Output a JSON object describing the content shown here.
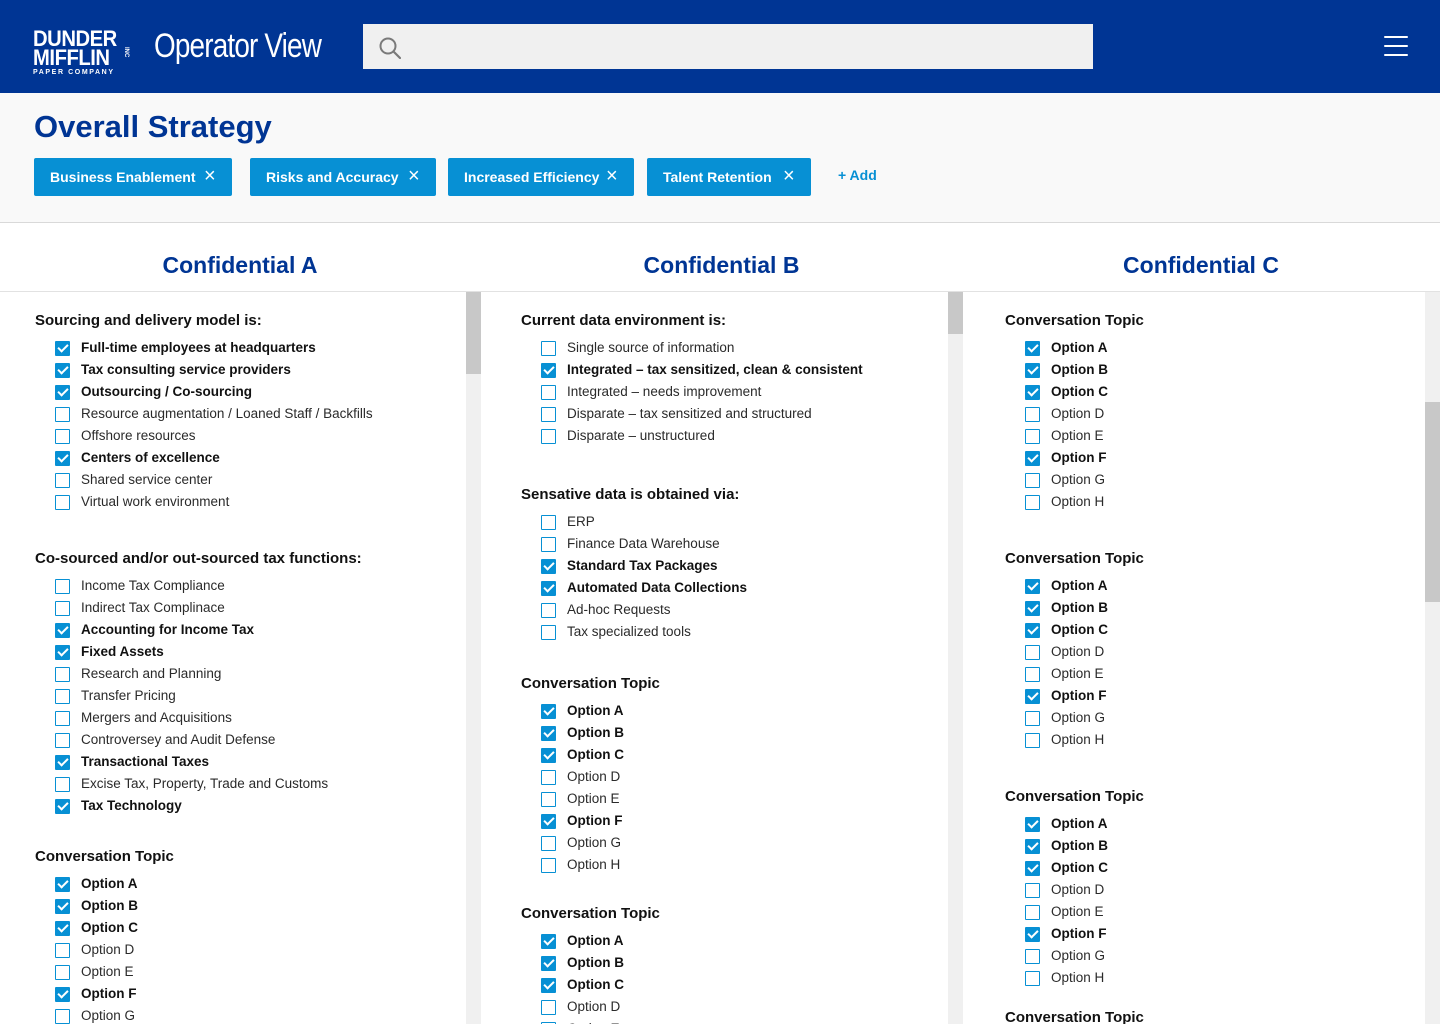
{
  "header": {
    "logo_line1": "DUNDER",
    "logo_line2": "MIFFLIN",
    "logo_sub": "PAPER COMPANY",
    "logo_inc": "INC",
    "app_title": "Operator View",
    "search_placeholder": ""
  },
  "strategy": {
    "title": "Overall Strategy",
    "tags": [
      "Business Enablement",
      "Risks and Accuracy",
      "Increased Efficiency",
      "Talent Retention"
    ],
    "remove_glyph": "×",
    "add_label": "+ Add"
  },
  "columns": [
    {
      "title": "Confidential A",
      "groups": [
        {
          "title": "Sourcing and delivery model is:",
          "options": [
            {
              "label": "Full-time employees at headquarters",
              "checked": true
            },
            {
              "label": "Tax consulting service providers",
              "checked": true
            },
            {
              "label": "Outsourcing / Co-sourcing",
              "checked": true
            },
            {
              "label": "Resource augmentation / Loaned Staff / Backfills",
              "checked": false
            },
            {
              "label": "Offshore resources",
              "checked": false
            },
            {
              "label": "Centers of excellence",
              "checked": true
            },
            {
              "label": "Shared service center",
              "checked": false
            },
            {
              "label": "Virtual work environment",
              "checked": false
            }
          ]
        },
        {
          "title": "Co-sourced and/or out-sourced tax functions:",
          "options": [
            {
              "label": "Income Tax Compliance",
              "checked": false
            },
            {
              "label": "Indirect Tax Complinace",
              "checked": false
            },
            {
              "label": "Accounting for Income Tax",
              "checked": true
            },
            {
              "label": "Fixed Assets",
              "checked": true
            },
            {
              "label": "Research and Planning",
              "checked": false
            },
            {
              "label": "Transfer Pricing",
              "checked": false
            },
            {
              "label": "Mergers and Acquisitions",
              "checked": false
            },
            {
              "label": "Controversey and Audit Defense",
              "checked": false
            },
            {
              "label": "Transactional Taxes",
              "checked": true
            },
            {
              "label": "Excise Tax, Property, Trade and Customs",
              "checked": false
            },
            {
              "label": "Tax Technology",
              "checked": true
            }
          ]
        },
        {
          "title": "Conversation Topic",
          "options": [
            {
              "label": "Option A",
              "checked": true
            },
            {
              "label": "Option B",
              "checked": true
            },
            {
              "label": "Option C",
              "checked": true
            },
            {
              "label": "Option D",
              "checked": false
            },
            {
              "label": "Option E",
              "checked": false
            },
            {
              "label": "Option F",
              "checked": true
            },
            {
              "label": "Option G",
              "checked": false
            }
          ]
        }
      ]
    },
    {
      "title": "Confidential B",
      "groups": [
        {
          "title": "Current data environment is:",
          "options": [
            {
              "label": "Single source of information",
              "checked": false
            },
            {
              "label": "Integrated – tax sensitized, clean & consistent",
              "checked": true
            },
            {
              "label": "Integrated – needs improvement",
              "checked": false
            },
            {
              "label": "Disparate – tax sensitized and structured",
              "checked": false
            },
            {
              "label": "Disparate – unstructured",
              "checked": false
            }
          ]
        },
        {
          "title": "Sensative data is obtained via:",
          "options": [
            {
              "label": "ERP",
              "checked": false
            },
            {
              "label": "Finance Data Warehouse",
              "checked": false
            },
            {
              "label": "Standard Tax Packages",
              "checked": true
            },
            {
              "label": "Automated Data Collections",
              "checked": true
            },
            {
              "label": "Ad-hoc Requests",
              "checked": false
            },
            {
              "label": "Tax specialized tools",
              "checked": false
            }
          ]
        },
        {
          "title": "Conversation Topic",
          "options": [
            {
              "label": "Option A",
              "checked": true
            },
            {
              "label": "Option B",
              "checked": true
            },
            {
              "label": "Option C",
              "checked": true
            },
            {
              "label": "Option D",
              "checked": false
            },
            {
              "label": "Option E",
              "checked": false
            },
            {
              "label": "Option F",
              "checked": true
            },
            {
              "label": "Option G",
              "checked": false
            },
            {
              "label": "Option H",
              "checked": false
            }
          ]
        },
        {
          "title": "Conversation Topic",
          "options": [
            {
              "label": "Option A",
              "checked": true
            },
            {
              "label": "Option B",
              "checked": true
            },
            {
              "label": "Option C",
              "checked": true
            },
            {
              "label": "Option D",
              "checked": false
            },
            {
              "label": "Option E",
              "checked": false
            }
          ]
        }
      ]
    },
    {
      "title": "Confidential C",
      "groups": [
        {
          "title": "Conversation Topic",
          "options": [
            {
              "label": "Option A",
              "checked": true
            },
            {
              "label": "Option B",
              "checked": true
            },
            {
              "label": "Option C",
              "checked": true
            },
            {
              "label": "Option D",
              "checked": false
            },
            {
              "label": "Option E",
              "checked": false
            },
            {
              "label": "Option F",
              "checked": true
            },
            {
              "label": "Option G",
              "checked": false
            },
            {
              "label": "Option H",
              "checked": false
            }
          ]
        },
        {
          "title": "Conversation Topic",
          "options": [
            {
              "label": "Option A",
              "checked": true
            },
            {
              "label": "Option B",
              "checked": true
            },
            {
              "label": "Option C",
              "checked": true
            },
            {
              "label": "Option D",
              "checked": false
            },
            {
              "label": "Option E",
              "checked": false
            },
            {
              "label": "Option F",
              "checked": true
            },
            {
              "label": "Option G",
              "checked": false
            },
            {
              "label": "Option H",
              "checked": false
            }
          ]
        },
        {
          "title": "Conversation Topic",
          "options": [
            {
              "label": "Option A",
              "checked": true
            },
            {
              "label": "Option B",
              "checked": true
            },
            {
              "label": "Option C",
              "checked": true
            },
            {
              "label": "Option D",
              "checked": false
            },
            {
              "label": "Option E",
              "checked": false
            },
            {
              "label": "Option F",
              "checked": true
            },
            {
              "label": "Option G",
              "checked": false
            },
            {
              "label": "Option H",
              "checked": false
            }
          ]
        },
        {
          "title": "Conversation Topic",
          "options": []
        }
      ]
    }
  ],
  "colors": {
    "brand_blue": "#003594",
    "accent_blue": "#0790d4"
  }
}
